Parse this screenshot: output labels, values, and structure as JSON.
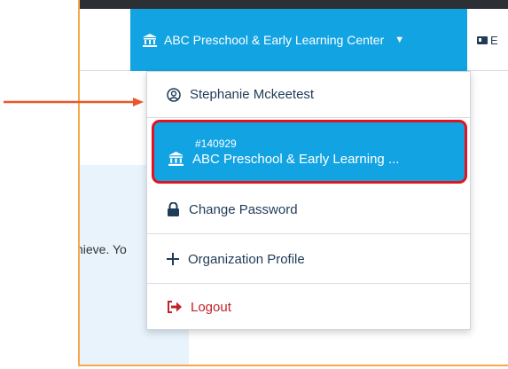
{
  "header": {
    "org_button_label": "ABC Preschool & Early Learning Center",
    "extra_label": "E"
  },
  "background": {
    "snippet": "hieve. Yo"
  },
  "dropdown": {
    "user_name": "Stephanie Mckeetest",
    "org_id": "#140929",
    "org_name": "ABC Preschool & Early Learning ...",
    "change_password": "Change Password",
    "organization_profile": "Organization Profile",
    "logout": "Logout"
  },
  "colors": {
    "accent": "#12a3e3",
    "highlight_border": "#e1131c",
    "frame_border": "#f7a84a",
    "arrow": "#e8572a",
    "logout": "#c0232a"
  },
  "icons": {
    "org": "bank-icon",
    "user": "user-circle-icon",
    "password": "lock-icon",
    "profile": "plus-icon",
    "logout": "sign-out-icon",
    "extra": "id-card-icon"
  }
}
